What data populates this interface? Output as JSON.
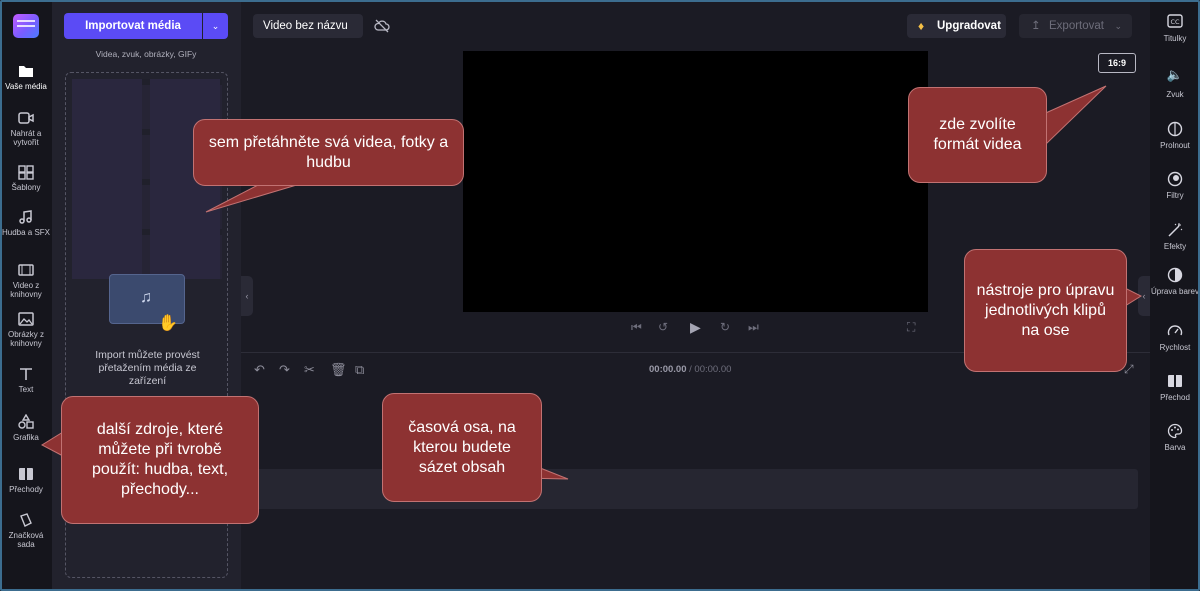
{
  "app": {
    "left_rail": [
      {
        "label": "Vaše média",
        "icon": "folder-icon"
      },
      {
        "label": "Nahrát a vytvořit",
        "icon": "camera-icon"
      },
      {
        "label": "Šablony",
        "icon": "templates-icon"
      },
      {
        "label": "Hudba a SFX",
        "icon": "music-icon"
      },
      {
        "label": "Video z knihovny",
        "icon": "film-icon"
      },
      {
        "label": "Obrázky z knihovny",
        "icon": "image-icon"
      },
      {
        "label": "Text",
        "icon": "text-icon"
      },
      {
        "label": "Grafika",
        "icon": "shapes-icon"
      },
      {
        "label": "Přechody",
        "icon": "transition-icon"
      },
      {
        "label": "Značková sada",
        "icon": "brand-icon"
      }
    ],
    "media_panel": {
      "import_label": "Importovat média",
      "subtitle": "Videa, zvuk, obrázky, GIFy",
      "drop_text": "Import můžete provést přetažením média ze zařízení"
    },
    "top_bar": {
      "project_title": "Video bez názvu",
      "upgrade_label": "Upgradovat",
      "export_label": "Exportovat"
    },
    "preview": {
      "aspect_ratio": "16:9"
    },
    "timeline": {
      "current_time": "00:00.00",
      "total_time": "/ 00:00.00"
    },
    "right_rail": [
      {
        "label": "Titulky",
        "icon": "captions-icon"
      },
      {
        "label": "Zvuk",
        "icon": "speaker-icon"
      },
      {
        "label": "Prolnout",
        "icon": "fade-icon"
      },
      {
        "label": "Filtry",
        "icon": "filter-icon"
      },
      {
        "label": "Efekty",
        "icon": "magic-wand-icon"
      },
      {
        "label": "Úprava barev",
        "icon": "contrast-icon"
      },
      {
        "label": "Rychlost",
        "icon": "speedometer-icon"
      },
      {
        "label": "Přechod",
        "icon": "transition-icon"
      },
      {
        "label": "Barva",
        "icon": "palette-icon"
      }
    ]
  },
  "callouts": {
    "drag_media": "sem přetáhněte svá videa, fotky a hudbu",
    "format": "zde zvolíte formát videa",
    "clip_tools": "nástroje pro úpravu jednotlivých klipů na ose",
    "sources": "další zdroje, které můžete při tvrobě použít: hudba, text, přechody...",
    "timeline": "časová osa, na kterou budete sázet obsah"
  },
  "colors": {
    "accent": "#5b4bf5",
    "callout": "#8d3232",
    "background": "#1b1b24"
  }
}
